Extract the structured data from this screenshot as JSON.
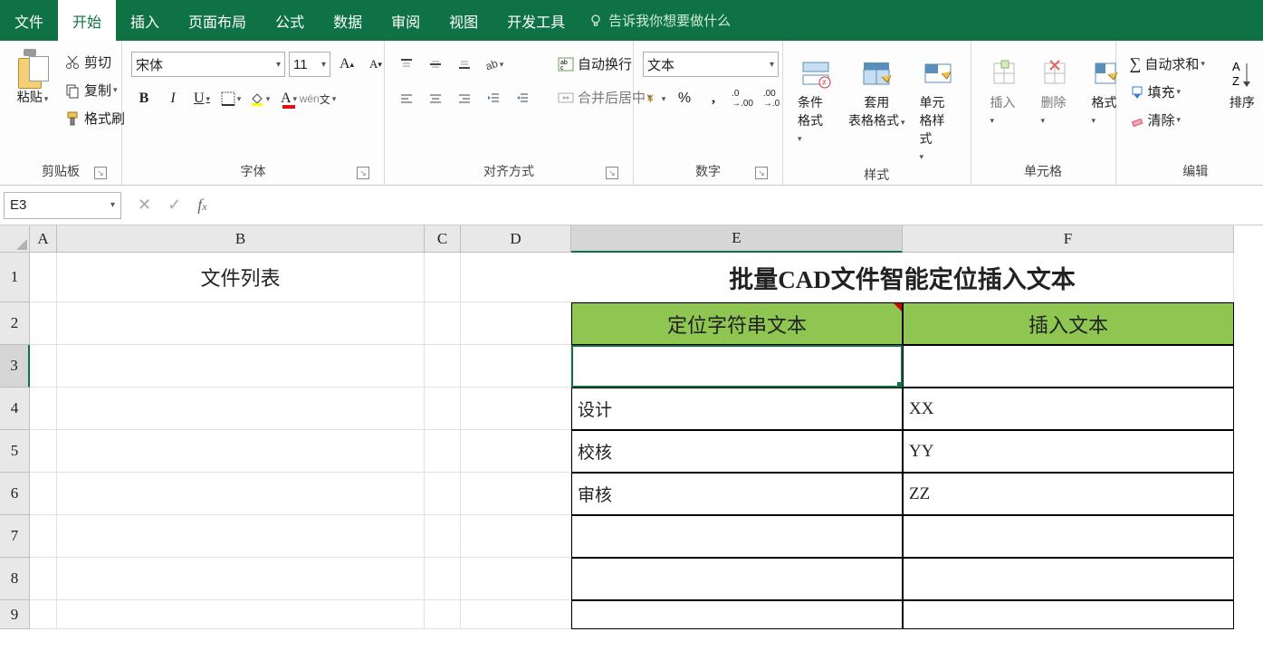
{
  "menu": {
    "tabs": [
      "文件",
      "开始",
      "插入",
      "页面布局",
      "公式",
      "数据",
      "审阅",
      "视图",
      "开发工具"
    ],
    "active": 1,
    "tell_me": "告诉我你想要做什么"
  },
  "ribbon": {
    "clipboard": {
      "paste": "粘贴",
      "cut": "剪切",
      "copy": "复制",
      "painter": "格式刷",
      "label": "剪贴板"
    },
    "font": {
      "name": "宋体",
      "size": "11",
      "label": "字体"
    },
    "align": {
      "wrap": "自动换行",
      "merge": "合并后居中",
      "label": "对齐方式"
    },
    "number": {
      "format": "文本",
      "label": "数字"
    },
    "styles": {
      "cond": "条件格式",
      "table": "套用\n表格格式",
      "cell": "单元格样式",
      "label": "样式"
    },
    "cells": {
      "insert": "插入",
      "delete": "删除",
      "format": "格式",
      "label": "单元格"
    },
    "editing": {
      "sum": "自动求和",
      "fill": "填充",
      "clear": "清除",
      "sort": "排序",
      "label": "编辑"
    }
  },
  "formula_bar": {
    "name_box": "E3",
    "formula": ""
  },
  "sheet": {
    "col_headers": [
      "A",
      "B",
      "C",
      "D",
      "E",
      "F"
    ],
    "row_headers": [
      "1",
      "2",
      "3",
      "4",
      "5",
      "6",
      "7",
      "8",
      "9"
    ],
    "selected_col_index": 4,
    "selected_row_index": 2,
    "data": {
      "B1": "文件列表",
      "E1_title": "批量CAD文件智能定位插入文本",
      "E2": "定位字符串文本",
      "F2": "插入文本",
      "E4": "设计",
      "F4": "XX",
      "E5": "校核",
      "F5": "YY",
      "E6": "审核",
      "F6": "ZZ"
    }
  }
}
